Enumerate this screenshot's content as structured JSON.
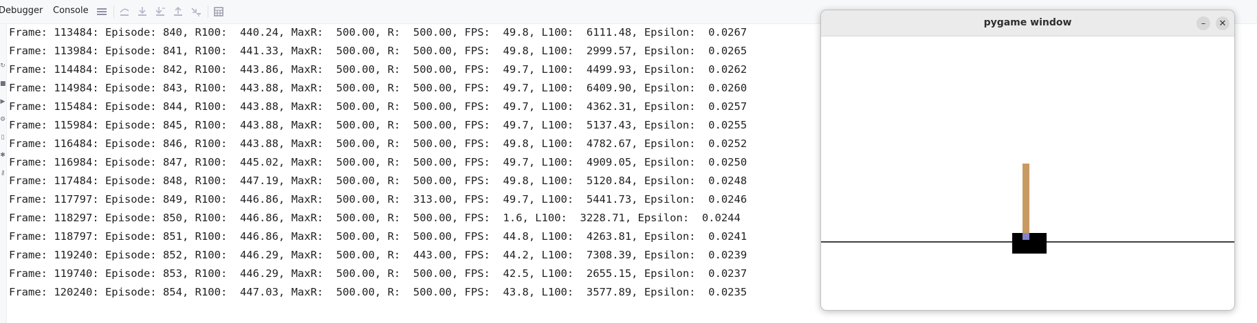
{
  "ide": {
    "tabs": [
      {
        "label": "Debugger"
      },
      {
        "label": "Console"
      }
    ],
    "toolbar_icons": [
      "menu-icon",
      "step-over-icon",
      "step-into-icon",
      "step-into-my-code-icon",
      "step-out-icon",
      "run-to-cursor-icon",
      "evaluate-expression-icon"
    ],
    "gutter_icons": [
      "rerun-icon",
      "stop-icon",
      "debug-icon",
      "settings-icon",
      "restore-layout-icon",
      "bug-icon",
      "key-icon"
    ]
  },
  "console": {
    "lines": [
      "Frame: 113484: Episode: 840, R100:  440.24, MaxR:  500.00, R:  500.00, FPS:  49.8, L100:  6111.48, Epsilon:  0.0267",
      "Frame: 113984: Episode: 841, R100:  441.33, MaxR:  500.00, R:  500.00, FPS:  49.8, L100:  2999.57, Epsilon:  0.0265",
      "Frame: 114484: Episode: 842, R100:  443.86, MaxR:  500.00, R:  500.00, FPS:  49.7, L100:  4499.93, Epsilon:  0.0262",
      "Frame: 114984: Episode: 843, R100:  443.88, MaxR:  500.00, R:  500.00, FPS:  49.7, L100:  6409.90, Epsilon:  0.0260",
      "Frame: 115484: Episode: 844, R100:  443.88, MaxR:  500.00, R:  500.00, FPS:  49.7, L100:  4362.31, Epsilon:  0.0257",
      "Frame: 115984: Episode: 845, R100:  443.88, MaxR:  500.00, R:  500.00, FPS:  49.7, L100:  5137.43, Epsilon:  0.0255",
      "Frame: 116484: Episode: 846, R100:  443.88, MaxR:  500.00, R:  500.00, FPS:  49.8, L100:  4782.67, Epsilon:  0.0252",
      "Frame: 116984: Episode: 847, R100:  445.02, MaxR:  500.00, R:  500.00, FPS:  49.7, L100:  4909.05, Epsilon:  0.0250",
      "Frame: 117484: Episode: 848, R100:  447.19, MaxR:  500.00, R:  500.00, FPS:  49.8, L100:  5120.84, Epsilon:  0.0248",
      "Frame: 117797: Episode: 849, R100:  446.86, MaxR:  500.00, R:  313.00, FPS:  49.7, L100:  5441.73, Epsilon:  0.0246",
      "Frame: 118297: Episode: 850, R100:  446.86, MaxR:  500.00, R:  500.00, FPS:  1.6, L100:  3228.71, Epsilon:  0.0244",
      "Frame: 118797: Episode: 851, R100:  446.86, MaxR:  500.00, R:  500.00, FPS:  44.8, L100:  4263.81, Epsilon:  0.0241",
      "Frame: 119240: Episode: 852, R100:  446.29, MaxR:  500.00, R:  443.00, FPS:  44.2, L100:  7308.39, Epsilon:  0.0239",
      "Frame: 119740: Episode: 853, R100:  446.29, MaxR:  500.00, R:  500.00, FPS:  42.5, L100:  2655.15, Epsilon:  0.0237",
      "Frame: 120240: Episode: 854, R100:  447.03, MaxR:  500.00, R:  500.00, FPS:  43.8, L100:  3577.89, Epsilon:  0.0235"
    ]
  },
  "pygame_window": {
    "title": "pygame window",
    "minimize_symbol": "–",
    "close_symbol": "✕",
    "colors": {
      "pole": "#c89a62",
      "cart": "#000000",
      "axle": "#8184cb",
      "track": "#000000",
      "background": "#ffffff"
    }
  }
}
